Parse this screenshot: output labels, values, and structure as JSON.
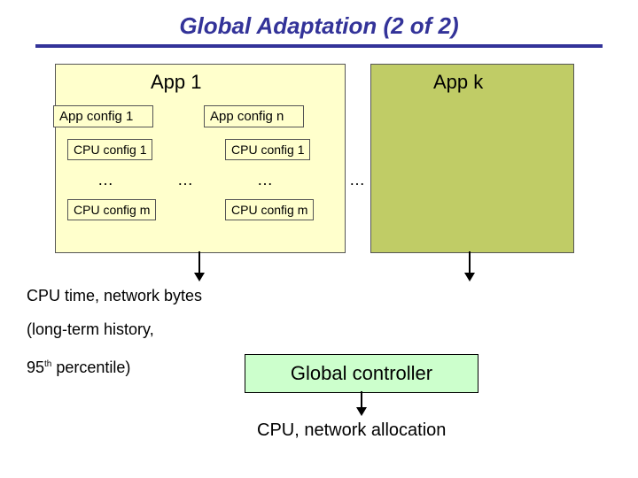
{
  "title": "Global Adaptation (2 of 2)",
  "app1": {
    "label": "App 1"
  },
  "appk": {
    "label": "App k"
  },
  "appconfig1": "App config 1",
  "appconfign": "App config n",
  "cpu": {
    "c1_left": "CPU config 1",
    "cm_left": "CPU config m",
    "c1_right": "CPU config 1",
    "cm_right": "CPU config m"
  },
  "ellipsis": "…",
  "text": {
    "l1": "CPU time, network bytes",
    "l2": "(long-term history,",
    "l3": "95ᵗʰ percentile)"
  },
  "controller": "Global controller",
  "output": "CPU, network allocation"
}
